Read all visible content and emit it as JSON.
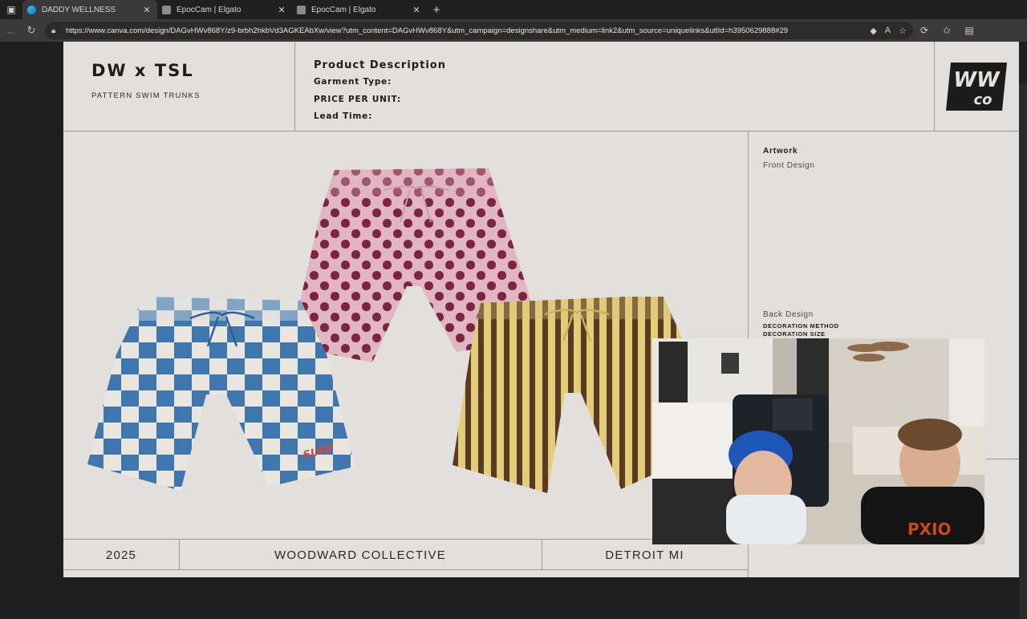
{
  "browser": {
    "tabs": [
      {
        "label": "DADDY WELLNESS",
        "active": true,
        "icon": "edge-icon"
      },
      {
        "label": "EpocCam | Elgato",
        "active": false,
        "icon": "elgato-icon"
      },
      {
        "label": "EpocCam | Elgato",
        "active": false,
        "icon": "elgato-icon"
      }
    ],
    "url": "https://www.canva.com/design/DAGvHWv868Y/z9-brbh2hkbVd3AGKEAbXw/view?utm_content=DAGvHWv868Y&utm_campaign=designshare&utm_medium=link2&utm_source=uniquelinks&utlId=h3950629888#29"
  },
  "sheet": {
    "title": "DW x TSL",
    "subtitle": "PATTERN SWIM TRUNKS",
    "description": {
      "heading": "Product Description",
      "garment_type": "Garment Type:",
      "price": "PRICE PER UNIT:",
      "lead_time": "Lead Time:"
    },
    "logo_text": "WW co",
    "artwork": {
      "heading": "Artwork",
      "front": "Front Design",
      "back": "Back Design",
      "decoration_method": "DECORATION METHOD",
      "decoration_size": "DECORATION SIZE"
    },
    "footer": {
      "year": "2025",
      "collective": "WOODWARD COLLECTIVE",
      "location": "DETROIT MI"
    },
    "products": [
      {
        "name": "blue-check-trunks",
        "pattern": "checkerboard",
        "colors": [
          "#3f76ad",
          "#e9e6df"
        ]
      },
      {
        "name": "maroon-dot-trunks",
        "pattern": "domino",
        "colors": [
          "#7c2444",
          "#e2b5c3"
        ]
      },
      {
        "name": "gold-stripe-trunks",
        "pattern": "stripes",
        "colors": [
          "#5b3a23",
          "#e3cd7b"
        ]
      }
    ]
  },
  "colors": {
    "page_bg": "#e2dfdc",
    "rule": "#9e9a96",
    "text": "#1c1c1c"
  }
}
